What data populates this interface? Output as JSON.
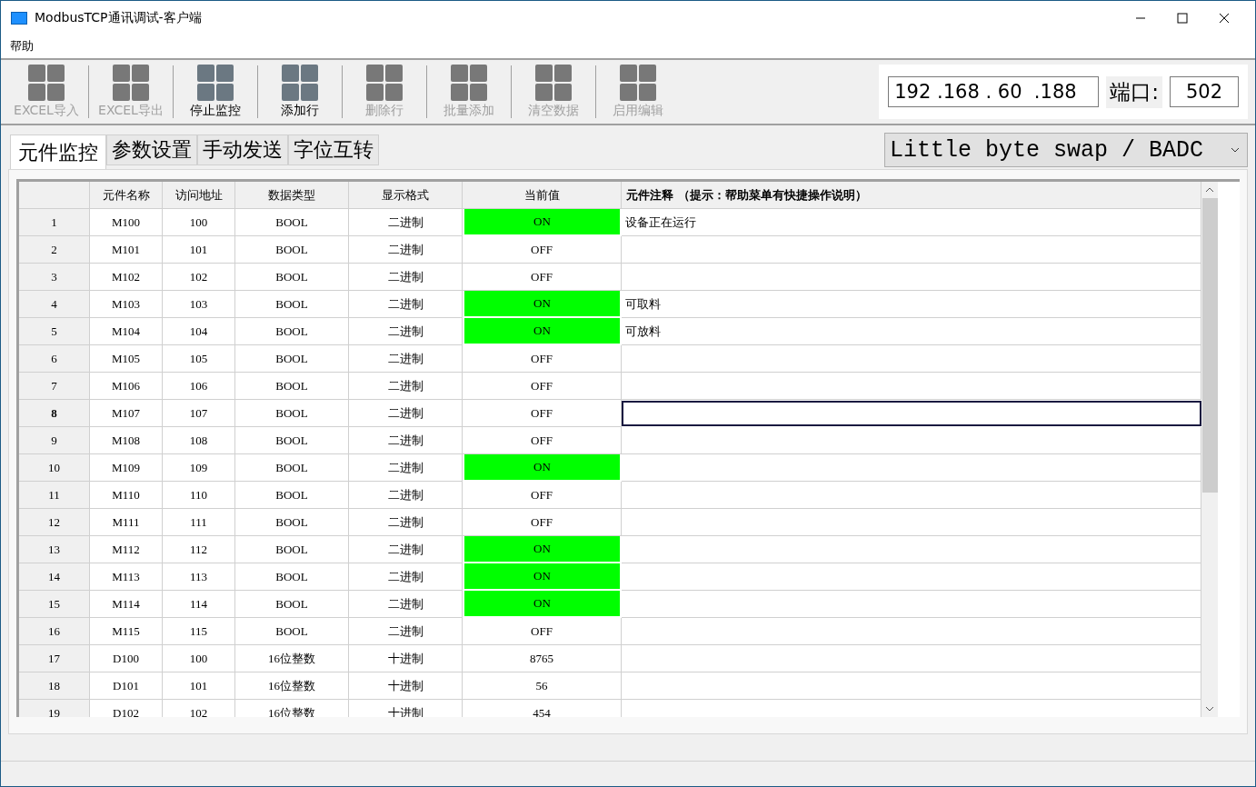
{
  "window": {
    "title": "ModbusTCP通讯调试-客户端"
  },
  "menu": [
    "帮助"
  ],
  "toolbar": [
    {
      "label": "EXCEL导入",
      "disabled": true
    },
    {
      "label": "EXCEL导出",
      "disabled": true
    },
    {
      "label": "停止监控",
      "disabled": false
    },
    {
      "label": "添加行",
      "disabled": false
    },
    {
      "label": "删除行",
      "disabled": true
    },
    {
      "label": "批量添加",
      "disabled": true
    },
    {
      "label": "清空数据",
      "disabled": true
    },
    {
      "label": "启用编辑",
      "disabled": true
    }
  ],
  "connection": {
    "ip_address": "192 .168 . 60  .188",
    "port_label": "端口:",
    "port": "502"
  },
  "tabs": [
    {
      "label": "元件监控",
      "selected": true
    },
    {
      "label": "参数设置",
      "selected": false
    },
    {
      "label": "手动发送",
      "selected": false
    },
    {
      "label": "字位互转",
      "selected": false
    }
  ],
  "byte_order": {
    "value": "Little byte swap / BADC"
  },
  "table": {
    "columns": [
      "元件名称",
      "访问地址",
      "数据类型",
      "显示格式",
      "当前值",
      "元件注释 （提示：帮助菜单有快捷操作说明）"
    ],
    "rows": [
      {
        "number": "1",
        "name": "M100",
        "address": "100",
        "type": "BOOL",
        "format": "二进制",
        "value": "ON",
        "on": true,
        "comment": "设备正在运行",
        "selected": false
      },
      {
        "number": "2",
        "name": "M101",
        "address": "101",
        "type": "BOOL",
        "format": "二进制",
        "value": "OFF",
        "on": false,
        "comment": "",
        "selected": false
      },
      {
        "number": "3",
        "name": "M102",
        "address": "102",
        "type": "BOOL",
        "format": "二进制",
        "value": "OFF",
        "on": false,
        "comment": "",
        "selected": false
      },
      {
        "number": "4",
        "name": "M103",
        "address": "103",
        "type": "BOOL",
        "format": "二进制",
        "value": "ON",
        "on": true,
        "comment": "可取料",
        "selected": false
      },
      {
        "number": "5",
        "name": "M104",
        "address": "104",
        "type": "BOOL",
        "format": "二进制",
        "value": "ON",
        "on": true,
        "comment": "可放料",
        "selected": false
      },
      {
        "number": "6",
        "name": "M105",
        "address": "105",
        "type": "BOOL",
        "format": "二进制",
        "value": "OFF",
        "on": false,
        "comment": "",
        "selected": false
      },
      {
        "number": "7",
        "name": "M106",
        "address": "106",
        "type": "BOOL",
        "format": "二进制",
        "value": "OFF",
        "on": false,
        "comment": "",
        "selected": false
      },
      {
        "number": "8",
        "name": "M107",
        "address": "107",
        "type": "BOOL",
        "format": "二进制",
        "value": "OFF",
        "on": false,
        "comment": "",
        "selected": true
      },
      {
        "number": "9",
        "name": "M108",
        "address": "108",
        "type": "BOOL",
        "format": "二进制",
        "value": "OFF",
        "on": false,
        "comment": "",
        "selected": false
      },
      {
        "number": "10",
        "name": "M109",
        "address": "109",
        "type": "BOOL",
        "format": "二进制",
        "value": "ON",
        "on": true,
        "comment": "",
        "selected": false
      },
      {
        "number": "11",
        "name": "M110",
        "address": "110",
        "type": "BOOL",
        "format": "二进制",
        "value": "OFF",
        "on": false,
        "comment": "",
        "selected": false
      },
      {
        "number": "12",
        "name": "M111",
        "address": "111",
        "type": "BOOL",
        "format": "二进制",
        "value": "OFF",
        "on": false,
        "comment": "",
        "selected": false
      },
      {
        "number": "13",
        "name": "M112",
        "address": "112",
        "type": "BOOL",
        "format": "二进制",
        "value": "ON",
        "on": true,
        "comment": "",
        "selected": false
      },
      {
        "number": "14",
        "name": "M113",
        "address": "113",
        "type": "BOOL",
        "format": "二进制",
        "value": "ON",
        "on": true,
        "comment": "",
        "selected": false
      },
      {
        "number": "15",
        "name": "M114",
        "address": "114",
        "type": "BOOL",
        "format": "二进制",
        "value": "ON",
        "on": true,
        "comment": "",
        "selected": false
      },
      {
        "number": "16",
        "name": "M115",
        "address": "115",
        "type": "BOOL",
        "format": "二进制",
        "value": "OFF",
        "on": false,
        "comment": "",
        "selected": false
      },
      {
        "number": "17",
        "name": "D100",
        "address": "100",
        "type": "16位整数",
        "format": "十进制",
        "value": "8765",
        "on": false,
        "comment": "",
        "selected": false
      },
      {
        "number": "18",
        "name": "D101",
        "address": "101",
        "type": "16位整数",
        "format": "十进制",
        "value": "56",
        "on": false,
        "comment": "",
        "selected": false
      },
      {
        "number": "19",
        "name": "D102",
        "address": "102",
        "type": "16位整数",
        "format": "十进制",
        "value": "454",
        "on": false,
        "comment": "",
        "selected": false
      }
    ]
  }
}
